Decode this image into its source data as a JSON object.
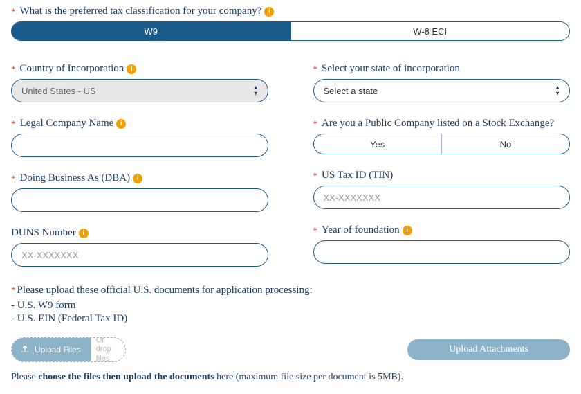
{
  "tax_class": {
    "label": "What is the preferred tax classification for your company?",
    "w9": "W9",
    "w8eci": "W-8 ECI"
  },
  "country": {
    "label": "Country of Incorporation",
    "value": "United States - US"
  },
  "state": {
    "label": "Select your state of incorporation",
    "placeholder": "Select a state"
  },
  "legal_name": {
    "label": "Legal Company Name"
  },
  "public_co": {
    "label": "Are you a Public Company listed on a Stock Exchange?",
    "yes": "Yes",
    "no": "No"
  },
  "dba": {
    "label": "Doing Business As (DBA)"
  },
  "tin": {
    "label": "US Tax ID (TIN)",
    "placeholder": "XX-XXXXXXX"
  },
  "duns": {
    "label": "DUNS Number",
    "placeholder": "XX-XXXXXXX"
  },
  "year": {
    "label": "Year of foundation"
  },
  "upload": {
    "heading": "Please upload these official U.S. documents for application processing:",
    "item1": "- U.S. W9 form",
    "item2": "- U.S. EIN (Federal Tax ID)",
    "btn_files": "Upload Files",
    "drop": "Or drop files",
    "btn_attach": "Upload Attachments"
  },
  "note": {
    "pre": "Please ",
    "bold": "choose the files then upload the documents",
    "post": " here (maximum file size per document is 5MB)."
  },
  "star": "*",
  "i": "i"
}
